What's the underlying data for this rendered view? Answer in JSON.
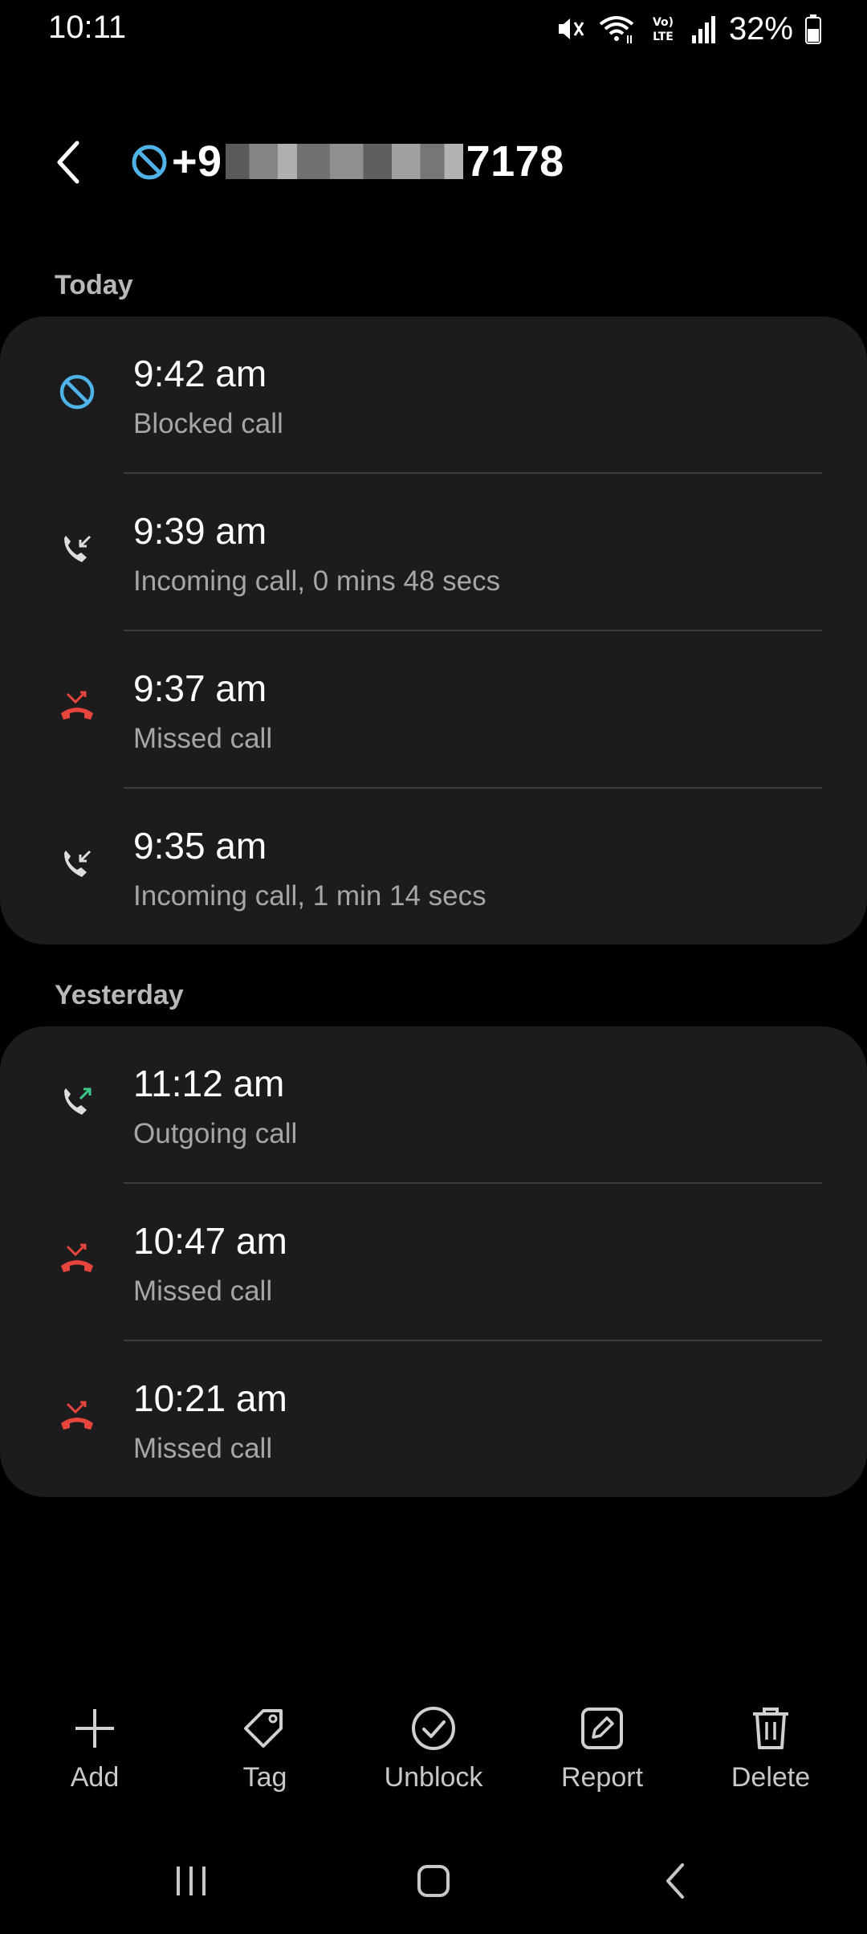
{
  "status_bar": {
    "time": "10:11",
    "battery": "32%",
    "icons": [
      "mute-icon",
      "wifi-icon",
      "volte-icon",
      "signal-icon",
      "battery-icon"
    ],
    "volte_label": "VoLTE"
  },
  "header": {
    "number_prefix": "+9",
    "number_suffix": "7178",
    "icons": [
      "back-icon",
      "blocked-icon"
    ]
  },
  "sections": [
    {
      "title": "Today",
      "calls": [
        {
          "time": "9:42 am",
          "detail": "Blocked call",
          "type": "blocked"
        },
        {
          "time": "9:39 am",
          "detail": "Incoming call, 0 mins 48 secs",
          "type": "incoming"
        },
        {
          "time": "9:37 am",
          "detail": "Missed call",
          "type": "missed"
        },
        {
          "time": "9:35 am",
          "detail": "Incoming call, 1 min 14 secs",
          "type": "incoming"
        }
      ]
    },
    {
      "title": "Yesterday",
      "calls": [
        {
          "time": "11:12 am",
          "detail": "Outgoing call",
          "type": "outgoing"
        },
        {
          "time": "10:47 am",
          "detail": "Missed call",
          "type": "missed"
        },
        {
          "time": "10:21 am",
          "detail": "Missed call",
          "type": "missed"
        }
      ]
    }
  ],
  "actions": [
    {
      "label": "Add",
      "icon": "plus-icon"
    },
    {
      "label": "Tag",
      "icon": "tag-icon"
    },
    {
      "label": "Unblock",
      "icon": "check-circle-icon"
    },
    {
      "label": "Report",
      "icon": "report-icon"
    },
    {
      "label": "Delete",
      "icon": "trash-icon"
    }
  ],
  "nav": [
    "recents-icon",
    "home-icon",
    "back-icon"
  ],
  "colors": {
    "blocked": "#4fb3e8",
    "missed": "#e6453c",
    "outgoing_arrow": "#3ec98a",
    "card_bg": "#1c1c1e"
  }
}
